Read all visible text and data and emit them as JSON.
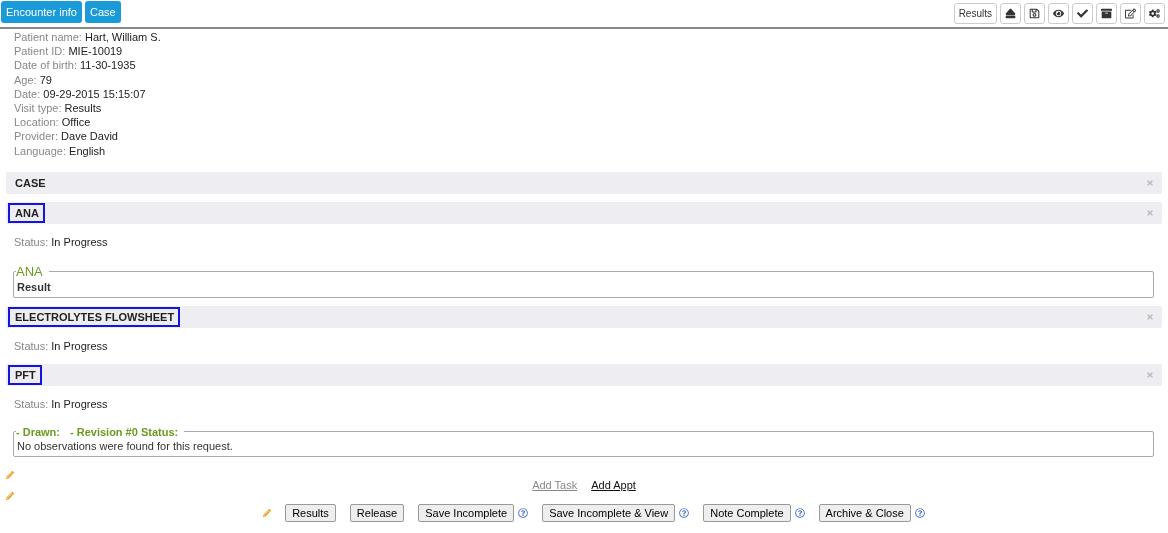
{
  "tabs": [
    {
      "label": "Encounter info"
    },
    {
      "label": "Case"
    }
  ],
  "toolbar": {
    "results_button": "Results"
  },
  "patient_info": [
    {
      "label": "Patient name:",
      "value": "Hart, William S."
    },
    {
      "label": "Patient ID:",
      "value": "MIE-10019"
    },
    {
      "label": "Date of birth:",
      "value": "11-30-1935"
    },
    {
      "label": "Age:",
      "value": "79"
    },
    {
      "label": "Date:",
      "value": "09-29-2015 15:15:07"
    },
    {
      "label": "Visit type:",
      "value": "Results"
    },
    {
      "label": "Location:",
      "value": "Office"
    },
    {
      "label": "Provider:",
      "value": "Dave David"
    },
    {
      "label": "Language:",
      "value": "English"
    }
  ],
  "sections": [
    {
      "title": "CASE",
      "highlighted": false
    },
    {
      "title": "ANA",
      "highlighted": true,
      "items": [
        {
          "kind": "status",
          "label": "Status:",
          "value": "In Progress"
        },
        {
          "kind": "fieldset",
          "legend": [
            "ANA"
          ],
          "body": "Result",
          "bold": true
        }
      ]
    },
    {
      "title": "ELECTROLYTES FLOWSHEET",
      "highlighted": true,
      "items": [
        {
          "kind": "status",
          "label": "Status:",
          "value": "In Progress"
        }
      ]
    },
    {
      "title": "PFT",
      "highlighted": true,
      "items": [
        {
          "kind": "status",
          "label": "Status:",
          "value": "In Progress"
        },
        {
          "kind": "fieldset",
          "legend": [
            "- Drawn:",
            "- Revision #0 Status:"
          ],
          "body": "No observations were found for this request.",
          "bold": false
        }
      ]
    }
  ],
  "links": [
    {
      "label": "Add Task",
      "disabled": true
    },
    {
      "label": "Add Appt",
      "disabled": false
    }
  ],
  "buttons": [
    {
      "label": "Results",
      "help": false
    },
    {
      "label": "Release",
      "help": false
    },
    {
      "label": "Save Incomplete",
      "help": true
    },
    {
      "label": "Save Incomplete & View",
      "help": true
    },
    {
      "label": "Note Complete",
      "help": true
    },
    {
      "label": "Archive & Close",
      "help": true
    }
  ]
}
